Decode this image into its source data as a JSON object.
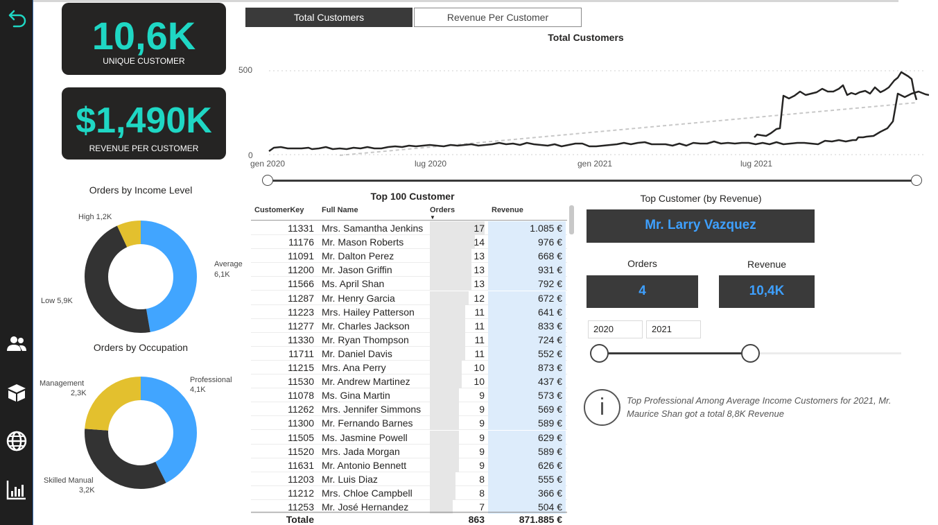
{
  "kpis": {
    "unique_customer": {
      "value": "10,6K",
      "label": "UNIQUE CUSTOMER"
    },
    "revenue_per_customer": {
      "value": "$1,490K",
      "label": "REVENUE PER CUSTOMER"
    }
  },
  "tabs": {
    "total_customers": "Total Customers",
    "revenue_per_customer": "Revenue Per Customer"
  },
  "line_chart": {
    "title": "Total Customers",
    "y_ticks": [
      "500",
      "0"
    ],
    "x_ticks": [
      "gen 2020",
      "lug 2020",
      "gen 2021",
      "lug 2021"
    ]
  },
  "donut_income": {
    "title": "Orders by Income Level",
    "labels": {
      "high": "High 1,2K",
      "average_1": "Average",
      "average_2": "6,1K",
      "low": "Low 5,9K"
    }
  },
  "donut_occupation": {
    "title": "Orders by Occupation",
    "labels": {
      "management_1": "Management",
      "management_2": "2,3K",
      "professional_1": "Professional",
      "professional_2": "4,1K",
      "skilled_1": "Skilled Manual",
      "skilled_2": "3,2K"
    }
  },
  "table": {
    "title": "Top 100 Customer",
    "headers": {
      "key": "CustomerKey",
      "name": "Full Name",
      "orders": "Orders",
      "revenue": "Revenue"
    },
    "rows": [
      {
        "key": "11331",
        "name": "Mrs. Samantha Jenkins",
        "orders": "17",
        "revenue": "1.085 €"
      },
      {
        "key": "11176",
        "name": "Mr. Mason Roberts",
        "orders": "14",
        "revenue": "976 €"
      },
      {
        "key": "11091",
        "name": "Mr. Dalton Perez",
        "orders": "13",
        "revenue": "668 €"
      },
      {
        "key": "11200",
        "name": "Mr. Jason Griffin",
        "orders": "13",
        "revenue": "931 €"
      },
      {
        "key": "11566",
        "name": "Ms. April Shan",
        "orders": "13",
        "revenue": "792 €"
      },
      {
        "key": "11287",
        "name": "Mr. Henry Garcia",
        "orders": "12",
        "revenue": "672 €"
      },
      {
        "key": "11223",
        "name": "Mrs. Hailey Patterson",
        "orders": "11",
        "revenue": "641 €"
      },
      {
        "key": "11277",
        "name": "Mr. Charles Jackson",
        "orders": "11",
        "revenue": "833 €"
      },
      {
        "key": "11330",
        "name": "Mr. Ryan Thompson",
        "orders": "11",
        "revenue": "724 €"
      },
      {
        "key": "11711",
        "name": "Mr. Daniel Davis",
        "orders": "11",
        "revenue": "552 €"
      },
      {
        "key": "11215",
        "name": "Mrs. Ana Perry",
        "orders": "10",
        "revenue": "873 €"
      },
      {
        "key": "11530",
        "name": "Mr. Andrew Martinez",
        "orders": "10",
        "revenue": "437 €"
      },
      {
        "key": "11078",
        "name": "Ms. Gina Martin",
        "orders": "9",
        "revenue": "573 €"
      },
      {
        "key": "11262",
        "name": "Mrs. Jennifer Simmons",
        "orders": "9",
        "revenue": "569 €"
      },
      {
        "key": "11300",
        "name": "Mr. Fernando Barnes",
        "orders": "9",
        "revenue": "589 €"
      },
      {
        "key": "11505",
        "name": "Ms. Jasmine Powell",
        "orders": "9",
        "revenue": "629 €"
      },
      {
        "key": "11520",
        "name": "Mrs. Jada Morgan",
        "orders": "9",
        "revenue": "589 €"
      },
      {
        "key": "11631",
        "name": "Mr. Antonio Bennett",
        "orders": "9",
        "revenue": "626 €"
      },
      {
        "key": "11203",
        "name": "Mr. Luis Diaz",
        "orders": "8",
        "revenue": "555 €"
      },
      {
        "key": "11212",
        "name": "Mrs. Chloe Campbell",
        "orders": "8",
        "revenue": "366 €"
      },
      {
        "key": "11253",
        "name": "Mr. José Hernandez",
        "orders": "7",
        "revenue": "504 €"
      }
    ],
    "total": {
      "label": "Totale",
      "orders": "863",
      "revenue": "871.885 €"
    }
  },
  "top_customer": {
    "title": "Top Customer (by Revenue)",
    "name": "Mr. Larry Vazquez",
    "orders_label": "Orders",
    "orders_value": "4",
    "revenue_label": "Revenue",
    "revenue_value": "10,4K"
  },
  "year_slicer": {
    "from": "2020",
    "to": "2021"
  },
  "insight": {
    "line1": "Top Professional Among Average Income Customers for 2021, Mr.",
    "line2": "Maurice Shan got a total 8,8K Revenue"
  },
  "colors": {
    "accent_teal": "#1fd7c4",
    "blue": "#41a5ff",
    "dark": "#252423",
    "yellow": "#e3c02e"
  }
}
